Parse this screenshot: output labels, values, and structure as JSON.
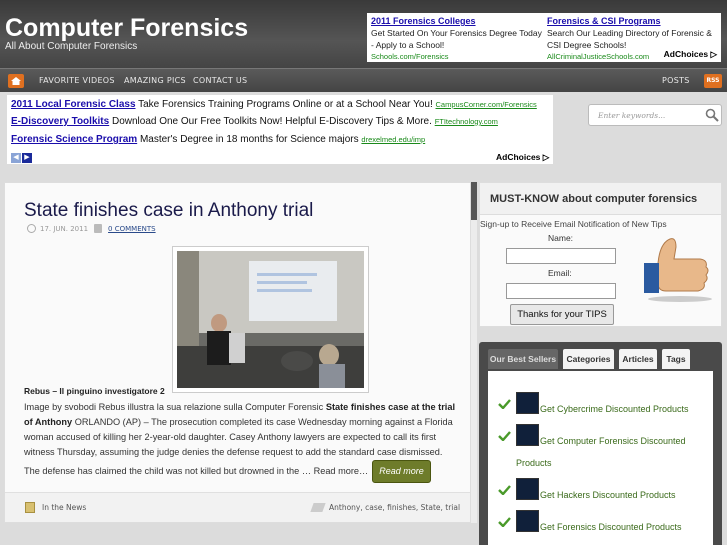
{
  "site": {
    "title": "Computer Forensics",
    "subtitle": "All About Computer Forensics"
  },
  "top_ad": {
    "col1": {
      "title": "2011 Forensics Colleges",
      "body": "Get Started On Your Forensics Degree Today - Apply to a School!",
      "url": "Schools.com/Forensics"
    },
    "col2": {
      "title": "Forensics & CSI Programs",
      "body": "Search Our Leading Directory of Forensic & CSI Degree Schools!",
      "url": "AllCriminalJusticeSchools.com"
    },
    "adchoices": "AdChoices"
  },
  "nav": {
    "items": [
      "FAVORITE VIDEOS",
      "AMAZING PICS",
      "CONTACT US"
    ],
    "posts": "POSTS",
    "rss": "RSS"
  },
  "link_ad": {
    "rows": [
      {
        "title": "2011 Local Forensic Class",
        "body": "Take Forensics Training Programs Online or at a School Near You!",
        "url": "CampusCorner.com/Forensics"
      },
      {
        "title": "E-Discovery Toolkits",
        "body": "Download One Our Free Toolkits Now! Helpful E-Discovery Tips & More.",
        "url": "FTItechnology.com"
      },
      {
        "title": "Forensic Science Program",
        "body": "Master's Degree in 18 months for Science majors",
        "url": "drexelmed.edu/imp"
      }
    ],
    "adchoices": "AdChoices"
  },
  "search": {
    "placeholder": "Enter keywords..."
  },
  "post": {
    "title": "State finishes case in Anthony trial",
    "date": "17. JUN. 2011",
    "comments": "0 COMMENTS",
    "caption": "Rebus – Il pinguino investigatore 2",
    "excerpt": {
      "p1": "Image by svobodi Rebus illustra la sua relazione sulla Computer Forensic ",
      "b1": "State finishes case at the trial of Anthony",
      "p2": " ORLANDO (AP) – The prosecution completed its case Wednesday morning against a Florida woman accused of killing her 2-year-old daughter. Casey Anthony lawyers are expected to call its first witness Thursday, assuming the judge denies the defense request to add the standard case dismissed. The defense has claimed the child was not killed but drowned in the … Read more…"
    },
    "read_more": "Read more",
    "category": "In the News",
    "tags": "Anthony, case, finishes, State, trial"
  },
  "newsletter": {
    "title": "MUST-KNOW about computer forensics",
    "intro": "Sign-up to Receive Email Notification of New Tips",
    "name_label": "Name:",
    "email_label": "Email:",
    "button": "Thanks for your TIPS"
  },
  "tabs": {
    "labels": [
      "Our Best Sellers",
      "Categories",
      "Articles",
      "Tags"
    ],
    "products": [
      "Get Cybercrime Discounted Products",
      "Get Computer Forensics Discounted",
      "Products",
      "Get Hackers Discounted Products",
      "Get Forensics Discounted Products"
    ]
  },
  "colors": {
    "header_bg": "#444444",
    "link_blue": "#1a0dab",
    "ad_url_green": "#1a8a1a",
    "read_more_bg": "#6e7c2a",
    "product_link": "#3a6a1a",
    "check_green": "#4a9a2a"
  },
  "icons": [
    "home-icon",
    "rss-icon",
    "search-icon",
    "clock-icon",
    "folder-icon",
    "tag-icon",
    "thumbs-up-icon",
    "checkmark-icon",
    "prev-arrow-icon",
    "next-arrow-icon"
  ]
}
